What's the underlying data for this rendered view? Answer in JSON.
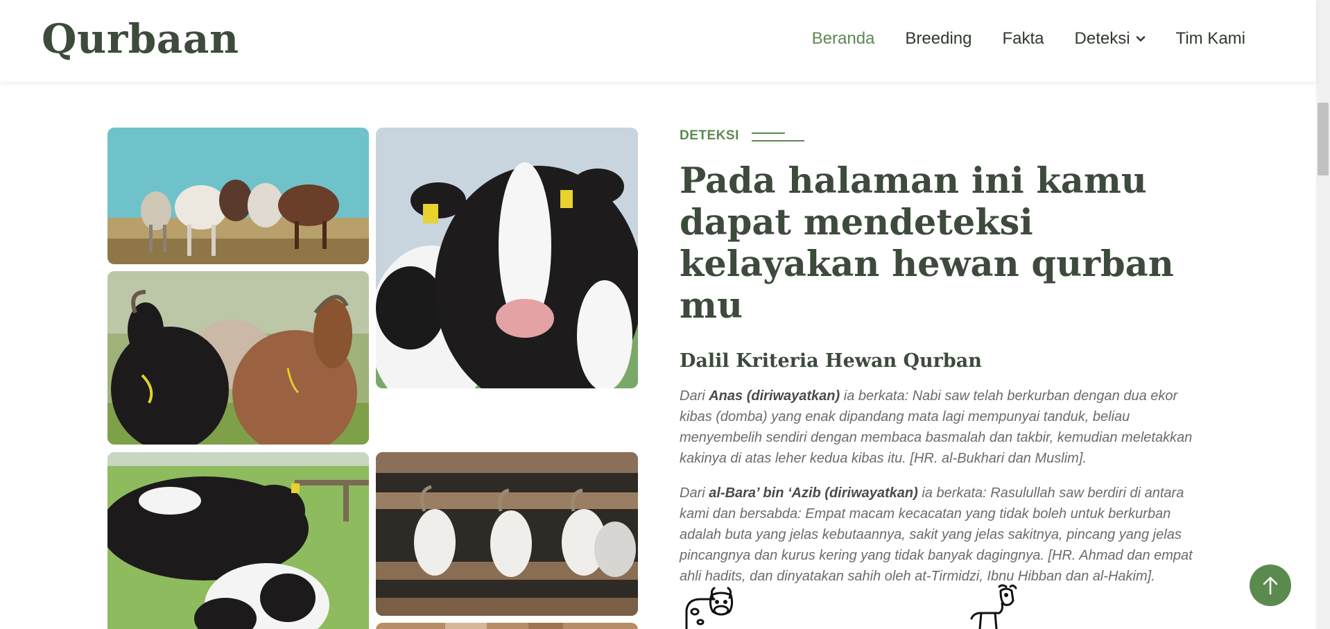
{
  "header": {
    "logo": "Qurbaan",
    "nav": [
      {
        "label": "Beranda",
        "active": true
      },
      {
        "label": "Breeding",
        "active": false
      },
      {
        "label": "Fakta",
        "active": false
      },
      {
        "label": "Deteksi",
        "active": false,
        "dropdown": true
      },
      {
        "label": "Tim Kami",
        "active": false
      }
    ]
  },
  "content": {
    "section_label": "DETEKSI",
    "title": "Pada halaman ini kamu dapat mendeteksi kelayakan hewan qurban mu",
    "subtitle": "Dalil Kriteria Hewan Qurban",
    "paragraph1": {
      "prefix": "Dari ",
      "narrator": "Anas (diriwayatkan)",
      "text": " ia berkata: Nabi saw telah berkurban dengan dua ekor kibas (domba) yang enak dipandang mata lagi mempunyai tanduk, beliau menyembelih sendiri dengan membaca basmalah dan takbir, kemudian meletakkan kakinya di atas leher kedua kibas itu. [HR. al-Bukhari dan Muslim]."
    },
    "paragraph2": {
      "prefix": "Dari ",
      "narrator": "al-Bara’ bin ‘Azib (diriwayatkan)",
      "text": " ia berkata: Rasulullah saw berdiri di antara kami dan bersabda: Empat macam kecacatan yang tidak boleh untuk berkurban adalah buta yang jelas kebutaannya, sakit yang jelas sakitnya, pincang yang jelas pincangnya dan kurus kering yang tidak banyak dagingnya. [HR. Ahmad dan empat ahli hadits, dan dinyatakan sahih oleh at-Tirmidzi, Ibnu Hibban dan al-Hakim]."
    }
  },
  "icons": {
    "cow": "cow-icon",
    "goat": "goat-icon",
    "back_to_top": "arrow-up-icon"
  },
  "colors": {
    "accent": "#5b8a4f",
    "heading": "#3d4a3c",
    "body_text": "#6b6b6b"
  }
}
